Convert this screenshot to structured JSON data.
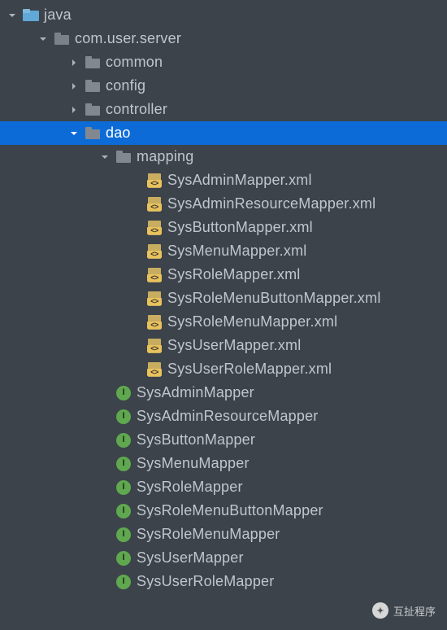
{
  "colors": {
    "bg": "#3c434a",
    "selection": "#0d6bd8",
    "text": "#c0c6cc",
    "folderSrc": "#5fa8d8",
    "folderPkg": "#82888f",
    "xmlAccent": "#eac25c",
    "interfaceAccent": "#5fa84f"
  },
  "tree": {
    "root": {
      "label": "java",
      "type": "src-folder",
      "expanded": true
    },
    "pkg": {
      "label": "com.user.server",
      "type": "package",
      "expanded": true
    },
    "children": [
      {
        "label": "common",
        "type": "package",
        "expanded": false
      },
      {
        "label": "config",
        "type": "package",
        "expanded": false
      },
      {
        "label": "controller",
        "type": "package",
        "expanded": false
      },
      {
        "label": "dao",
        "type": "package",
        "expanded": true,
        "selected": true,
        "children": [
          {
            "label": "mapping",
            "type": "package",
            "expanded": true,
            "children": [
              {
                "label": "SysAdminMapper.xml",
                "type": "xml"
              },
              {
                "label": "SysAdminResourceMapper.xml",
                "type": "xml"
              },
              {
                "label": "SysButtonMapper.xml",
                "type": "xml"
              },
              {
                "label": "SysMenuMapper.xml",
                "type": "xml"
              },
              {
                "label": "SysRoleMapper.xml",
                "type": "xml"
              },
              {
                "label": "SysRoleMenuButtonMapper.xml",
                "type": "xml"
              },
              {
                "label": "SysRoleMenuMapper.xml",
                "type": "xml"
              },
              {
                "label": "SysUserMapper.xml",
                "type": "xml"
              },
              {
                "label": "SysUserRoleMapper.xml",
                "type": "xml"
              }
            ]
          },
          {
            "label": "SysAdminMapper",
            "type": "interface"
          },
          {
            "label": "SysAdminResourceMapper",
            "type": "interface"
          },
          {
            "label": "SysButtonMapper",
            "type": "interface"
          },
          {
            "label": "SysMenuMapper",
            "type": "interface"
          },
          {
            "label": "SysRoleMapper",
            "type": "interface"
          },
          {
            "label": "SysRoleMenuButtonMapper",
            "type": "interface"
          },
          {
            "label": "SysRoleMenuMapper",
            "type": "interface"
          },
          {
            "label": "SysUserMapper",
            "type": "interface"
          },
          {
            "label": "SysUserRoleMapper",
            "type": "interface"
          }
        ]
      }
    ]
  },
  "watermark": {
    "label": "互扯程序"
  }
}
